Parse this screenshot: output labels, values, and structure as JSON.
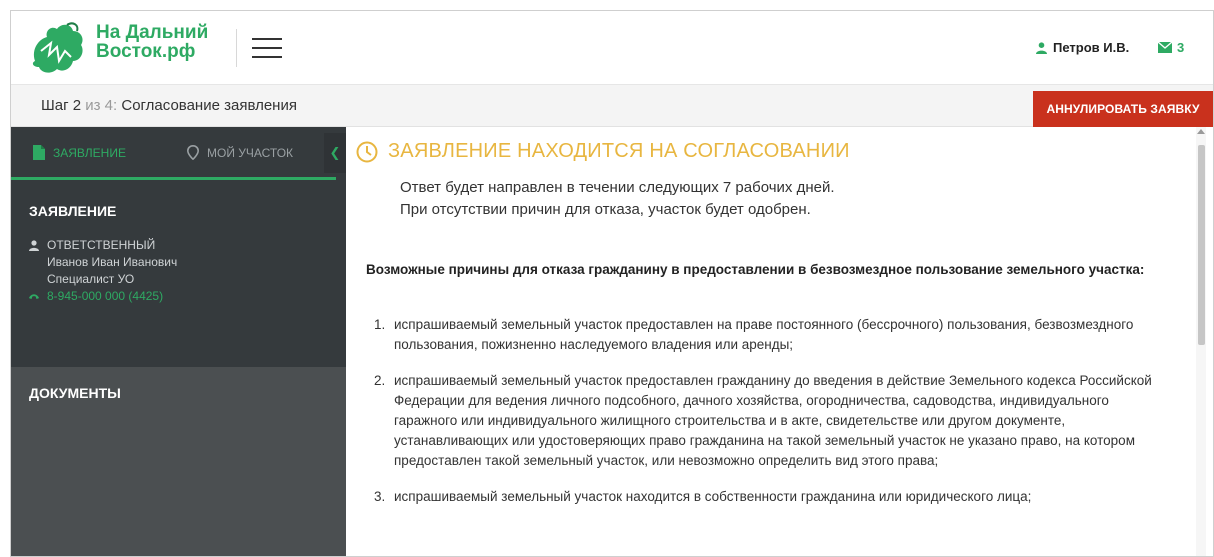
{
  "header": {
    "brand_line1": "На Дальний",
    "brand_line2": "Восток.рф",
    "user_name": "Петров И.В.",
    "messages_count": "3"
  },
  "stepbar": {
    "step_label": "Шаг",
    "step_current": "2",
    "step_of": "из 4:",
    "step_title": "Согласование заявления",
    "cancel_button": "АННУЛИРОВАТЬ ЗАЯВКУ"
  },
  "sidebar": {
    "tabs": [
      {
        "label": "ЗАЯВЛЕНИЕ",
        "icon": "document-icon",
        "active": true
      },
      {
        "label": "МОЙ УЧАСТОК",
        "icon": "map-pin-icon",
        "active": false
      }
    ],
    "section_application": "ЗАЯВЛЕНИЕ",
    "responsible_label": "ОТВЕТСТВЕННЫЙ",
    "responsible_name": "Иванов Иван Иванович",
    "responsible_role": "Специалист УО",
    "responsible_phone": "8-945-000 000 (4425)",
    "section_documents": "ДОКУМЕНТЫ"
  },
  "main": {
    "status_title": "ЗАЯВЛЕНИЕ НАХОДИТСЯ НА СОГЛАСОВАНИИ",
    "note_line1": "Ответ будет направлен в течении следующих 7 рабочих дней.",
    "note_line2": "При отсутствии причин для отказа, участок будет одобрен.",
    "reasons_title": "Возможные причины для отказа гражданину в предоставлении в безвозмездное пользование земельного участка:",
    "reasons": [
      {
        "num": "1.",
        "text": "испрашиваемый земельный участок предоставлен на праве постоянного (бессрочного) пользования, безвозмездного пользования, пожизненно наследуемого владения или аренды;"
      },
      {
        "num": "2.",
        "text": "испрашиваемый земельный участок предоставлен гражданину до введения в действие Земельного кодекса Российской Федерации для ведения личного подсобного, дачного хозяйства, огородничества, садоводства, индивидуального гаражного или индивидуального жилищного строительства и в акте, свидетельстве или другом документе, устанавливающих или удостоверяющих право гражданина на такой земельный участок не указано право, на котором предоставлен такой земельный участок, или невозможно определить вид этого права;"
      },
      {
        "num": "3.",
        "text": "испрашиваемый земельный участок находится в собственности гражданина или юридического лица;"
      }
    ]
  },
  "colors": {
    "brand_green": "#2eaa63",
    "cancel_red": "#c9311d",
    "status_yellow": "#e8b640",
    "sidebar_dark": "#353a3d",
    "sidebar_mid": "#4b4f51"
  }
}
